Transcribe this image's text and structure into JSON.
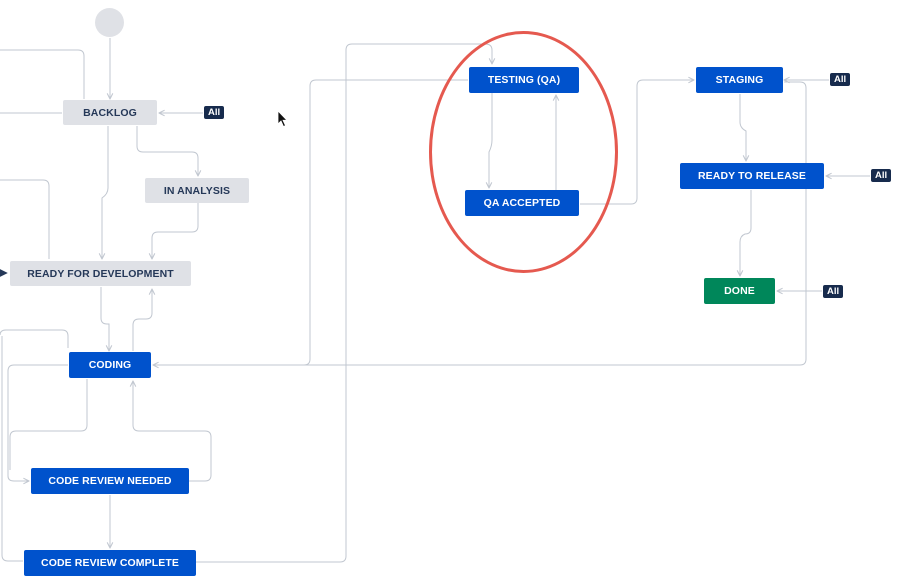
{
  "workflow": {
    "statuses": {
      "backlog": {
        "label": "BACKLOG",
        "category": "todo"
      },
      "in_analysis": {
        "label": "IN ANALYSIS",
        "category": "todo"
      },
      "ready_for_development": {
        "label": "READY FOR DEVELOPMENT",
        "category": "todo"
      },
      "coding": {
        "label": "CODING",
        "category": "in-progress"
      },
      "code_review_needed": {
        "label": "CODE REVIEW NEEDED",
        "category": "in-progress"
      },
      "code_review_complete": {
        "label": "CODE REVIEW COMPLETE",
        "category": "in-progress"
      },
      "testing_qa": {
        "label": "TESTING (QA)",
        "category": "in-progress"
      },
      "qa_accepted": {
        "label": "QA ACCEPTED",
        "category": "in-progress"
      },
      "staging": {
        "label": "STAGING",
        "category": "in-progress"
      },
      "ready_to_release": {
        "label": "READY TO RELEASE",
        "category": "in-progress"
      },
      "done": {
        "label": "DONE",
        "category": "done"
      }
    },
    "all_badges": {
      "backlog": "All",
      "staging": "All",
      "ready_to_release": "All",
      "done": "All"
    },
    "highlighted": [
      "testing_qa",
      "qa_accepted"
    ]
  },
  "colors": {
    "todo_bg": "#dfe1e6",
    "todo_text": "#253858",
    "in_progress_bg": "#0052cc",
    "done_bg": "#00875a",
    "badge_bg": "#172b4d",
    "connector": "#c1c7d0",
    "highlight": "#e5594f"
  },
  "icons": {
    "start": "start-circle-icon",
    "cursor": "mouse-pointer-icon"
  }
}
